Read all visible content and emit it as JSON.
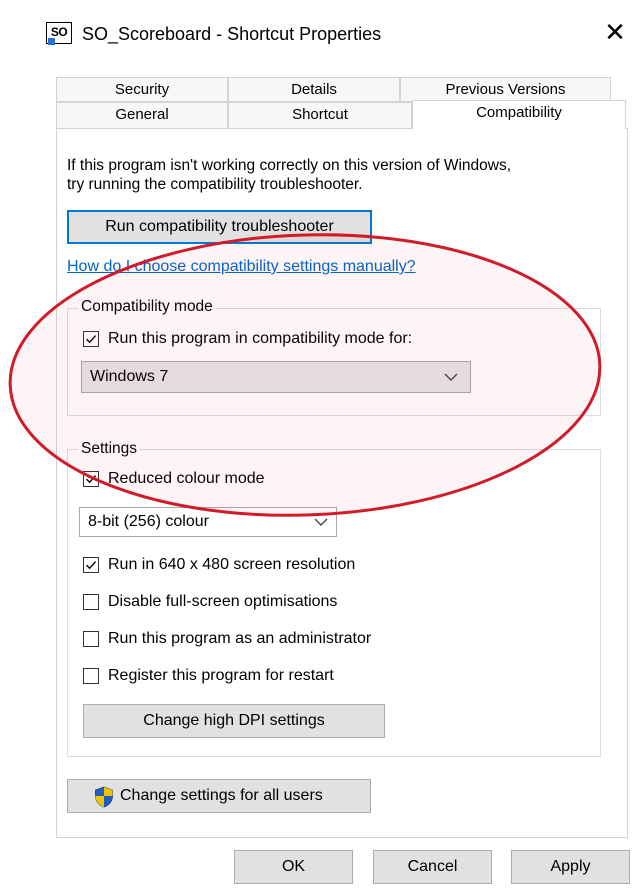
{
  "window": {
    "icon_text": "SO",
    "title": "SO_Scoreboard - Shortcut Properties",
    "close_glyph": "✕"
  },
  "tabs": {
    "row1": [
      "Security",
      "Details",
      "Previous Versions"
    ],
    "row2": [
      "General",
      "Shortcut",
      "Compatibility"
    ],
    "active": "Compatibility"
  },
  "intro": {
    "line1": "If this program isn't working correctly on this version of Windows,",
    "line2": "try running the compatibility troubleshooter."
  },
  "troubleshooter_button": "Run compatibility troubleshooter",
  "manual_link": "How do I choose compatibility settings manually?",
  "compat_mode": {
    "legend": "Compatibility mode",
    "checkbox_label": "Run this program in compatibility mode for:",
    "checked": true,
    "selected_os": "Windows 7"
  },
  "settings": {
    "legend": "Settings",
    "reduced_colour": {
      "label": "Reduced colour mode",
      "checked": true
    },
    "colour_depth": "8-bit (256) colour",
    "res640": {
      "label": "Run in 640 x 480 screen resolution",
      "checked": true
    },
    "disable_fullscreen": {
      "label": "Disable full-screen optimisations",
      "checked": false
    },
    "run_admin": {
      "label": "Run this program as an administrator",
      "checked": false
    },
    "register_restart": {
      "label": "Register this program for restart",
      "checked": false
    },
    "dpi_button": "Change high DPI settings"
  },
  "all_users_button": "Change settings for all users",
  "footer": {
    "ok": "OK",
    "cancel": "Cancel",
    "apply": "Apply"
  },
  "colors": {
    "link": "#0066cc",
    "focus": "#0078d7",
    "annotation": "#d11a2a",
    "shield_blue": "#1f5fbf",
    "shield_yellow": "#f2c200"
  }
}
